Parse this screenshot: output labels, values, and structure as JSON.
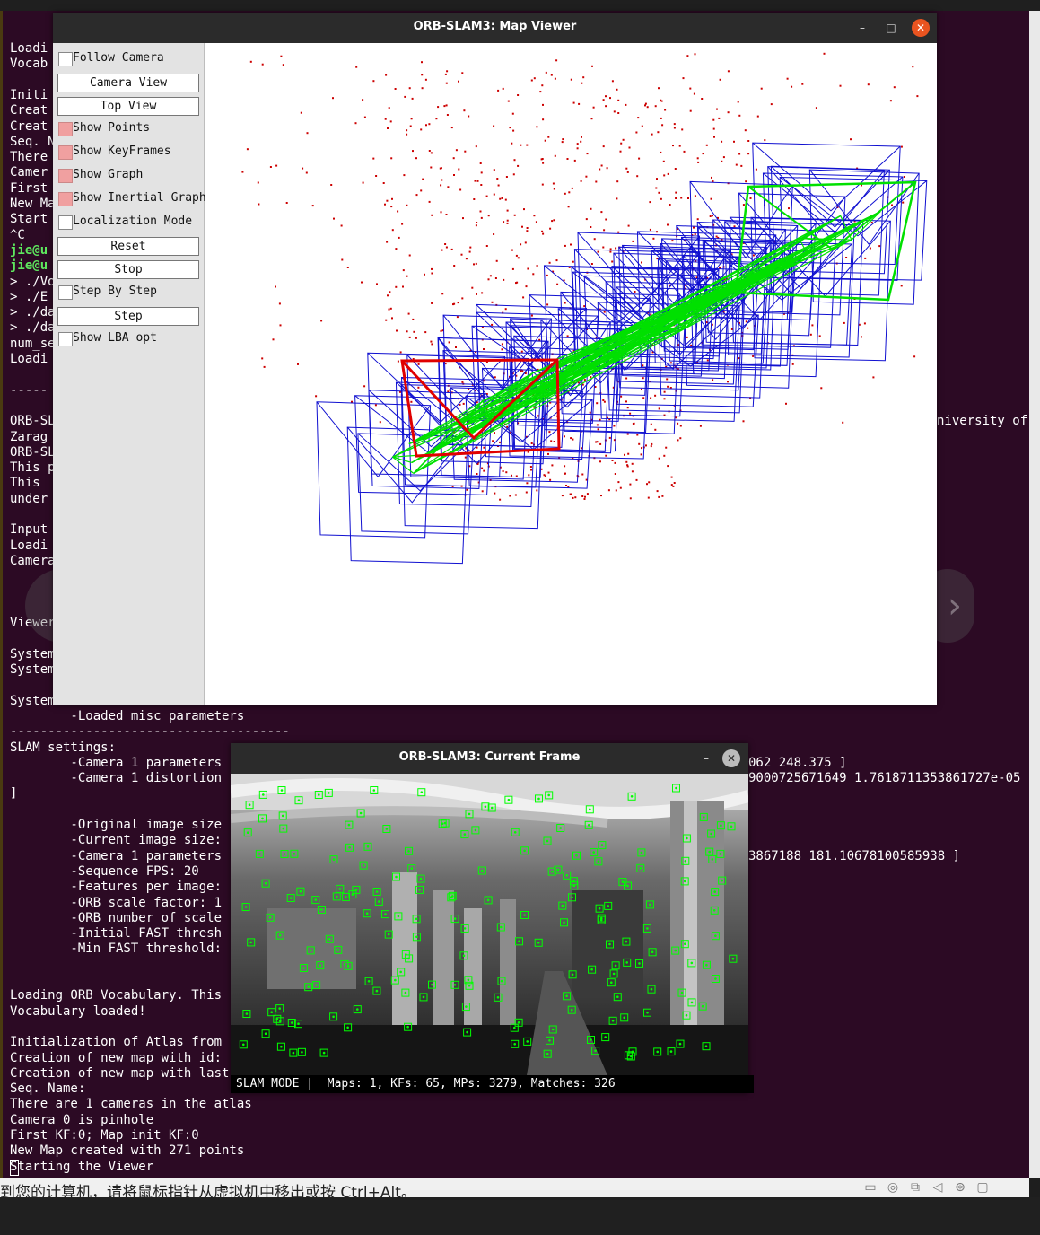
{
  "terminal": {
    "lines": [
      {
        "text": "Loadi",
        "color": "white"
      },
      {
        "text": "Vocab",
        "color": "white"
      },
      {
        "text": "",
        "color": "white"
      },
      {
        "text": "Initi",
        "color": "white"
      },
      {
        "text": "Creat",
        "color": "white"
      },
      {
        "text": "Creat",
        "color": "white"
      },
      {
        "text": "Seq. N",
        "color": "white"
      },
      {
        "text": "There",
        "color": "white"
      },
      {
        "text": "Camer",
        "color": "white"
      },
      {
        "text": "First",
        "color": "white"
      },
      {
        "text": "New Ma",
        "color": "white"
      },
      {
        "text": "Start",
        "color": "white"
      },
      {
        "text": "^C",
        "color": "white"
      },
      {
        "text": "jie@u",
        "color": "green"
      },
      {
        "text": "jie@u",
        "color": "green"
      },
      {
        "text": "> ./Vo",
        "color": "white"
      },
      {
        "text": "> ./E",
        "color": "white"
      },
      {
        "text": "> ./da",
        "color": "white"
      },
      {
        "text": "> ./da",
        "color": "white"
      },
      {
        "text": "num_se",
        "color": "white"
      },
      {
        "text": "Loadi",
        "color": "white"
      },
      {
        "text": "",
        "color": "white"
      },
      {
        "text": "-----",
        "color": "white"
      },
      {
        "text": "",
        "color": "white"
      },
      {
        "text": "ORB-SL",
        "color": "white"
      },
      {
        "text": "Zarag",
        "color": "white"
      },
      {
        "text": "ORB-SL",
        "color": "white"
      },
      {
        "text": "This p",
        "color": "white"
      },
      {
        "text": "This",
        "color": "white"
      },
      {
        "text": "under",
        "color": "white"
      },
      {
        "text": "",
        "color": "white"
      },
      {
        "text": "Input",
        "color": "white"
      },
      {
        "text": "Loadi",
        "color": "white"
      },
      {
        "text": "Camera",
        "color": "white"
      },
      {
        "text": "",
        "color": "white"
      },
      {
        "text": "",
        "color": "white"
      },
      {
        "text": "",
        "color": "white"
      },
      {
        "text": "Viewer",
        "color": "white"
      },
      {
        "text": "",
        "color": "white"
      },
      {
        "text": "System",
        "color": "white"
      },
      {
        "text": "System",
        "color": "white"
      },
      {
        "text": "",
        "color": "white"
      },
      {
        "text": "System",
        "color": "white"
      },
      {
        "text": "        -Loaded misc parameters",
        "color": "white"
      },
      {
        "text": "-------------------------------------",
        "color": "white"
      },
      {
        "text": "SLAM settings:",
        "color": "white"
      },
      {
        "text": "        -Camera 1 parameters",
        "color": "white"
      },
      {
        "text": "        -Camera 1 distortion",
        "color": "white"
      },
      {
        "text": "]",
        "color": "white"
      },
      {
        "text": "",
        "color": "white"
      },
      {
        "text": "        -Original image size",
        "color": "white"
      },
      {
        "text": "        -Current image size:",
        "color": "white"
      },
      {
        "text": "        -Camera 1 parameters",
        "color": "white"
      },
      {
        "text": "        -Sequence FPS: 20",
        "color": "white"
      },
      {
        "text": "        -Features per image:",
        "color": "white"
      },
      {
        "text": "        -ORB scale factor: 1",
        "color": "white"
      },
      {
        "text": "        -ORB number of scale",
        "color": "white"
      },
      {
        "text": "        -Initial FAST thresh",
        "color": "white"
      },
      {
        "text": "        -Min FAST threshold:",
        "color": "white"
      },
      {
        "text": "",
        "color": "white"
      },
      {
        "text": "",
        "color": "white"
      },
      {
        "text": "Loading ORB Vocabulary. This",
        "color": "white"
      },
      {
        "text": "Vocabulary loaded!",
        "color": "white"
      },
      {
        "text": "",
        "color": "white"
      },
      {
        "text": "Initialization of Atlas from",
        "color": "white"
      },
      {
        "text": "Creation of new map with id:",
        "color": "white"
      },
      {
        "text": "Creation of new map with last",
        "color": "white"
      },
      {
        "text": "Seq. Name:",
        "color": "white"
      },
      {
        "text": "There are 1 cameras in the atlas",
        "color": "white"
      },
      {
        "text": "Camera 0 is pinhole",
        "color": "white"
      },
      {
        "text": "First KF:0; Map init KF:0",
        "color": "white"
      },
      {
        "text": "New Map created with 271 points",
        "color": "white"
      },
      {
        "text": "Starting the Viewer",
        "color": "white"
      }
    ],
    "right_fragments": [
      {
        "text": "niversity of",
        "line": 24,
        "col": 1044
      },
      {
        "text": "062 248.375 ]",
        "line": 46,
        "col": 834
      },
      {
        "text": "9000725671649 1.7618711353861727e-05",
        "line": 47,
        "col": 834
      },
      {
        "text": "3867188 181.10678100585938 ]",
        "line": 52,
        "col": 834
      }
    ]
  },
  "vm_status": {
    "message": "到您的计算机，请将鼠标指针从虚拟机中移出或按 Ctrl+Alt。",
    "icons": [
      "disk-icon",
      "cd-icon",
      "network-icon",
      "sound-icon",
      "usb-icon",
      "display-icon"
    ]
  },
  "map_viewer": {
    "title": "ORB-SLAM3: Map Viewer",
    "controls": {
      "minimize": "–",
      "maximize": "□",
      "close": "✕"
    },
    "panel": [
      {
        "kind": "checkbox",
        "label": "Follow Camera",
        "checked": false
      },
      {
        "kind": "button",
        "label": "Camera View"
      },
      {
        "kind": "button",
        "label": "Top View"
      },
      {
        "kind": "checkbox",
        "label": "Show Points",
        "checked": true
      },
      {
        "kind": "checkbox",
        "label": "Show KeyFrames",
        "checked": true
      },
      {
        "kind": "checkbox",
        "label": "Show Graph",
        "checked": true
      },
      {
        "kind": "checkbox",
        "label": "Show Inertial Graph",
        "checked": true
      },
      {
        "kind": "checkbox",
        "label": "Localization Mode",
        "checked": false
      },
      {
        "kind": "button",
        "label": "Reset"
      },
      {
        "kind": "button",
        "label": "Stop"
      },
      {
        "kind": "checkbox",
        "label": "Step By Step",
        "checked": false
      },
      {
        "kind": "button",
        "label": "Step"
      },
      {
        "kind": "checkbox",
        "label": "Show LBA opt",
        "checked": false
      }
    ],
    "colors": {
      "map_points": "#cc0000",
      "keyframes": "#1010d0",
      "graph": "#00e000",
      "current_camera": "#e00000",
      "panel_bg": "#e3e3e3",
      "titlebar": "#2b2b2b",
      "accent_close": "#e95420"
    }
  },
  "current_frame": {
    "title": "ORB-SLAM3: Current Frame",
    "controls": {
      "minimize": "–",
      "close": "✕"
    },
    "status_text": "SLAM MODE |  Maps: 1, KFs: 65, MPs: 3279, Matches: 326",
    "feature_color": "#00ff00"
  },
  "nav": {
    "prev_icon": "‹",
    "next_icon": "›"
  }
}
